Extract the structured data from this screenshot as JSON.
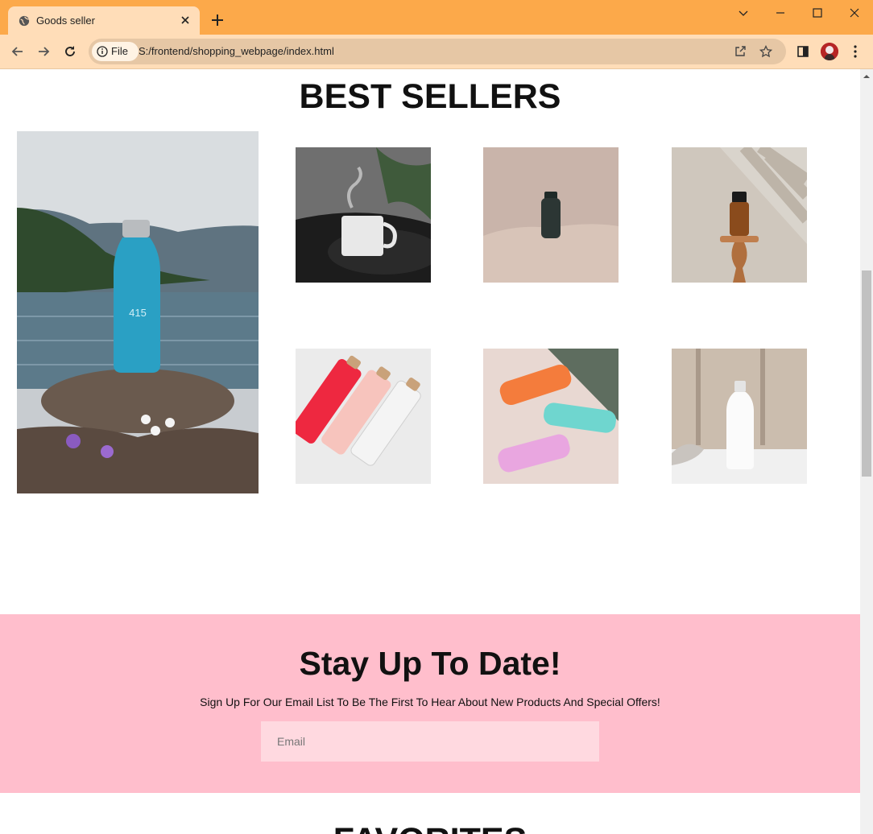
{
  "browser": {
    "tab_title": "Goods seller",
    "chip_label": "File",
    "url": "S:/frontend/shopping_webpage/index.html"
  },
  "page": {
    "best_sellers_heading": "BEST SELLERS",
    "products": [
      {
        "name": "blue-bottle-on-rock"
      },
      {
        "name": "coffee-mug"
      },
      {
        "name": "black-bottle"
      },
      {
        "name": "amber-dropper-bottle"
      },
      {
        "name": "glass-bottles"
      },
      {
        "name": "colorful-bottles"
      },
      {
        "name": "white-bottle"
      }
    ],
    "newsletter": {
      "heading": "Stay Up To Date!",
      "subtext": "Sign Up For Our Email List To Be The First To Hear About New Products And Special Offers!",
      "email_placeholder": "Email",
      "email_value": ""
    },
    "favorites_heading": "FAVORITES"
  },
  "colors": {
    "titlebar": "#fca94a",
    "toolbar": "#ffddb8",
    "newsletter_bg": "#ffbecc",
    "email_bg": "#ffd9e0"
  }
}
